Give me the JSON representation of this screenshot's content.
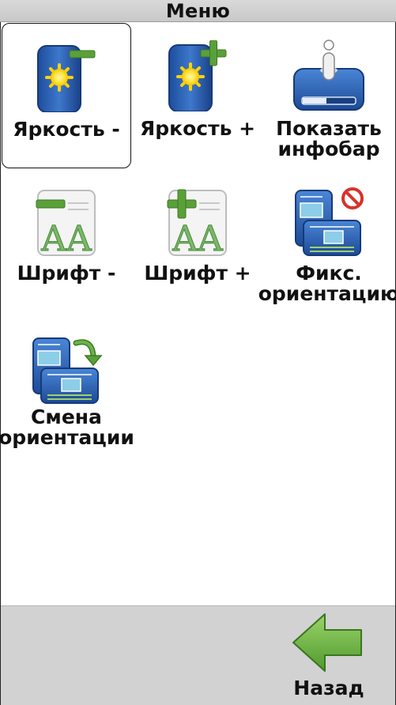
{
  "title": "Меню",
  "items": [
    {
      "label_lines": [
        "Яркость -"
      ],
      "icon": "brightness-minus-icon"
    },
    {
      "label_lines": [
        "Яркость +"
      ],
      "icon": "brightness-plus-icon"
    },
    {
      "label_lines": [
        "Показать",
        "инфобар"
      ],
      "icon": "show-infobar-icon"
    },
    {
      "label_lines": [
        "Шрифт -"
      ],
      "icon": "font-minus-icon"
    },
    {
      "label_lines": [
        "Шрифт +"
      ],
      "icon": "font-plus-icon"
    },
    {
      "label_lines": [
        "Фикс.",
        "ориентацию"
      ],
      "icon": "fix-orientation-icon"
    },
    {
      "label_lines": [
        "Смена",
        "ориентации"
      ],
      "icon": "rotate-orientation-icon"
    }
  ],
  "back": {
    "label": "Назад",
    "icon": "back-arrow-icon"
  },
  "colors": {
    "icon_blue": "#2b5fb0",
    "plus_green": "#5aa03a",
    "sun_yellow": "#ffe23a",
    "no_red": "#d8322a"
  }
}
